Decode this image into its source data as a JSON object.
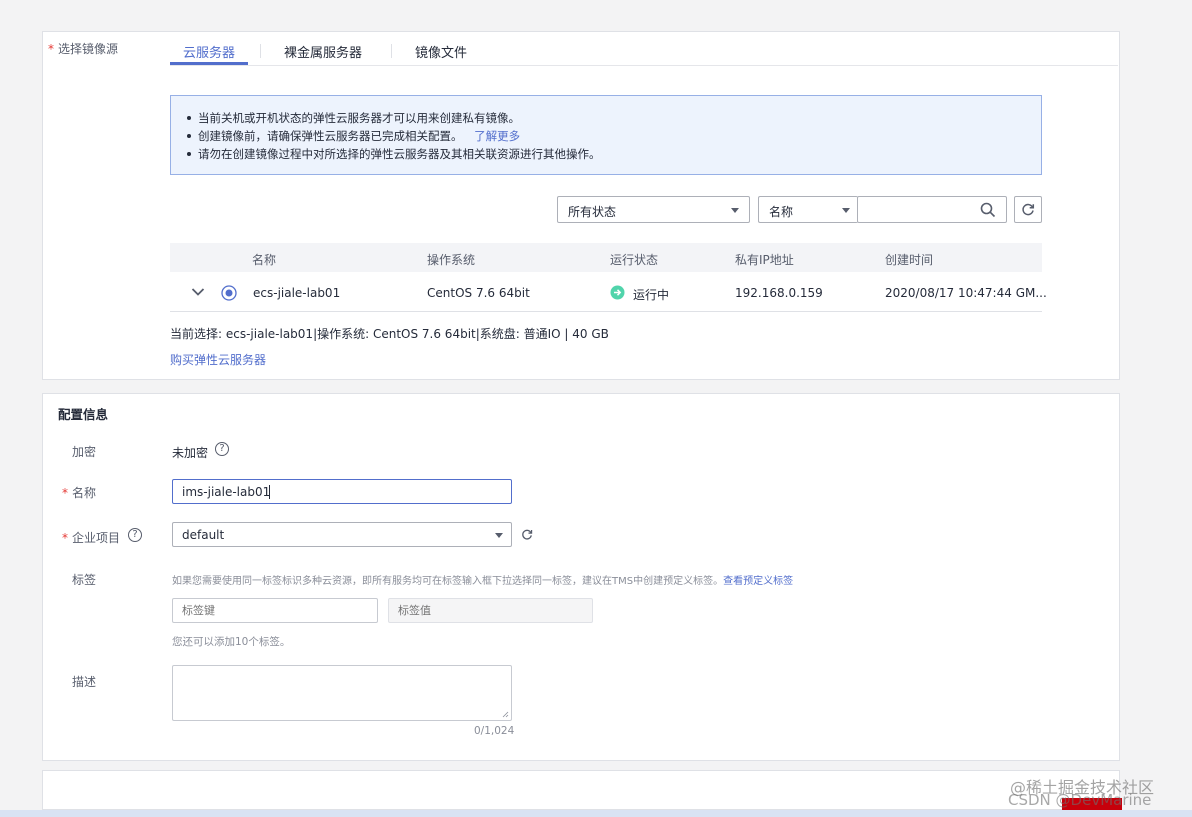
{
  "source": {
    "label": "选择镜像源",
    "tabs": [
      {
        "label": "云服务器"
      },
      {
        "label": "裸金属服务器"
      },
      {
        "label": "镜像文件"
      }
    ],
    "notice": {
      "line1": "当前关机或开机状态的弹性云服务器才可以用来创建私有镜像。",
      "line2": "创建镜像前，请确保弹性云服务器已完成相关配置。",
      "learn_more": "了解更多",
      "line3": "请勿在创建镜像过程中对所选择的弹性云服务器及其相关联资源进行其他操作。"
    },
    "filters": {
      "status_value": "所有状态",
      "field_value": "名称"
    },
    "table": {
      "headers": [
        "名称",
        "操作系统",
        "运行状态",
        "私有IP地址",
        "创建时间"
      ],
      "row": {
        "name": "ecs-jiale-lab01",
        "os": "CentOS 7.6 64bit",
        "status": "运行中",
        "ip": "192.168.0.159",
        "created": "2020/08/17 10:47:44 GM..."
      }
    },
    "current_selection": "当前选择: ecs-jiale-lab01|操作系统: CentOS 7.6 64bit|系统盘: 普通IO | 40 GB",
    "buy_link": "购买弹性云服务器"
  },
  "config": {
    "title": "配置信息",
    "encryption_label": "加密",
    "encryption_value": "未加密",
    "name_label": "名称",
    "name_value": "ims-jiale-lab01",
    "project_label": "企业项目",
    "project_value": "default",
    "tag_label": "标签",
    "tag_hint": "如果您需要使用同一标签标识多种云资源，即所有服务均可在标签输入框下拉选择同一标签，建议在TMS中创建预定义标签。",
    "tag_hint_link": "查看预定义标签",
    "tag_key_placeholder": "标签键",
    "tag_value_placeholder": "标签值",
    "tag_remaining": "您还可以添加10个标签。",
    "desc_label": "描述",
    "desc_counter": "0/1,024"
  },
  "watermark": {
    "line1": "@稀土掘金技术社区",
    "line2": "CSDN @DevMarine"
  },
  "colors": {
    "accent": "#526ecc",
    "required": "#e53935",
    "running": "#50d4ab",
    "notice_bg": "#edf3fd"
  }
}
